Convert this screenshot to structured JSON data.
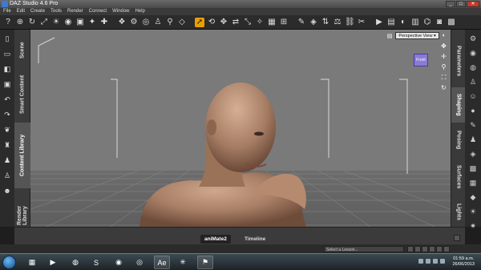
{
  "window": {
    "title": "DAZ Studio 4.6 Pro",
    "controls": [
      "_",
      "□",
      "✕"
    ]
  },
  "menu": [
    "File",
    "Edit",
    "Create",
    "Tools",
    "Render",
    "Connect",
    "Window",
    "Help"
  ],
  "toolbar_icons": [
    "help-icon",
    "select-icon",
    "rotate-icon",
    "scale-icon",
    "light-icon",
    "camera-icon",
    "geometry-icon",
    "node-icon",
    "translate-icon",
    "universal-icon",
    "pointer-icon",
    "orbit-icon",
    "pose-icon",
    "move-icon",
    "region-icon",
    "spot-icon",
    "surface-icon",
    "morph-icon",
    "brush-icon",
    "joint-icon",
    "render-icon",
    "render-settings-icon",
    "preview-icon"
  ],
  "left_tabs": [
    "Scene",
    "Smart Content",
    "Content Library",
    "Render Library"
  ],
  "left_active": "Content Library",
  "right_tabs": [
    "Parameters",
    "Shaping",
    "Posing",
    "Surfaces",
    "Lights"
  ],
  "right_active": "Shaping",
  "viewport": {
    "camera": "Perspective View",
    "nav_cube_label": "Front"
  },
  "bottom_tabs": [
    "aniMate2",
    "Timeline"
  ],
  "bottom_active": "aniMate2",
  "status": {
    "lesson_placeholder": "Select a Lesson..."
  },
  "taskbar": {
    "apps": [
      "explorer",
      "media-player",
      "firefox",
      "skype",
      "chrome",
      "blender",
      "after-effects",
      "zbrush",
      "acrobat"
    ],
    "clock_time": "01:59 a.m.",
    "clock_date": "26/06/2013"
  },
  "colors": {
    "accent_active": "#e8a000",
    "viewport_bg": "#7a7a7a",
    "nav_cube": "#8a7ad8"
  }
}
